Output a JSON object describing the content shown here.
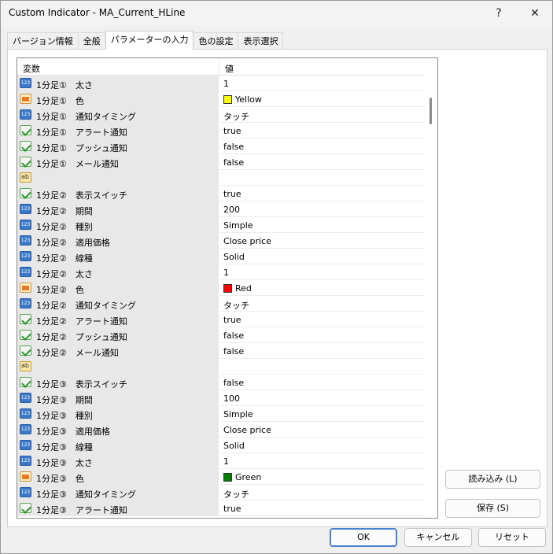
{
  "window": {
    "title": "Custom Indicator - MA_Current_HLine",
    "help_label": "?",
    "close_label": "✕"
  },
  "tabs": [
    {
      "label": "バージョン情報"
    },
    {
      "label": "全般"
    },
    {
      "label": "パラメーターの入力"
    },
    {
      "label": "色の設定"
    },
    {
      "label": "表示選択"
    }
  ],
  "grid": {
    "col_variable": "変数",
    "col_value": "値",
    "rows": [
      {
        "icon": "num",
        "name": "1分足①　太さ",
        "value": "1"
      },
      {
        "icon": "color",
        "name": "1分足①　色",
        "value": "Yellow",
        "swatch": "#ffff00"
      },
      {
        "icon": "num",
        "name": "1分足①　通知タイミング",
        "value": "タッチ"
      },
      {
        "icon": "bool",
        "name": "1分足①　アラート通知",
        "value": "true"
      },
      {
        "icon": "bool",
        "name": "1分足①　プッシュ通知",
        "value": "false"
      },
      {
        "icon": "bool",
        "name": "1分足①　メール通知",
        "value": "false"
      },
      {
        "icon": "str",
        "name": "",
        "value": ""
      },
      {
        "icon": "bool",
        "name": "1分足②　表示スイッチ",
        "value": "true"
      },
      {
        "icon": "num",
        "name": "1分足②　期間",
        "value": "200"
      },
      {
        "icon": "num",
        "name": "1分足②　種別",
        "value": "Simple"
      },
      {
        "icon": "num",
        "name": "1分足②　適用価格",
        "value": "Close price"
      },
      {
        "icon": "num",
        "name": "1分足②　線種",
        "value": "Solid"
      },
      {
        "icon": "num",
        "name": "1分足②　太さ",
        "value": "1"
      },
      {
        "icon": "color",
        "name": "1分足②　色",
        "value": "Red",
        "swatch": "#ff0000"
      },
      {
        "icon": "num",
        "name": "1分足②　通知タイミング",
        "value": "タッチ"
      },
      {
        "icon": "bool",
        "name": "1分足②　アラート通知",
        "value": "true"
      },
      {
        "icon": "bool",
        "name": "1分足②　プッシュ通知",
        "value": "false"
      },
      {
        "icon": "bool",
        "name": "1分足②　メール通知",
        "value": "false"
      },
      {
        "icon": "str",
        "name": "",
        "value": ""
      },
      {
        "icon": "bool",
        "name": "1分足③　表示スイッチ",
        "value": "false"
      },
      {
        "icon": "num",
        "name": "1分足③　期間",
        "value": "100"
      },
      {
        "icon": "num",
        "name": "1分足③　種別",
        "value": "Simple"
      },
      {
        "icon": "num",
        "name": "1分足③　適用価格",
        "value": "Close price"
      },
      {
        "icon": "num",
        "name": "1分足③　線種",
        "value": "Solid"
      },
      {
        "icon": "num",
        "name": "1分足③　太さ",
        "value": "1"
      },
      {
        "icon": "color",
        "name": "1分足③　色",
        "value": "Green",
        "swatch": "#008000"
      },
      {
        "icon": "num",
        "name": "1分足③　通知タイミング",
        "value": "タッチ"
      },
      {
        "icon": "bool",
        "name": "1分足③　アラート通知",
        "value": "true"
      }
    ]
  },
  "buttons": {
    "load": "読み込み (L)",
    "save": "保存 (S)",
    "ok": "OK",
    "cancel": "キャンセル",
    "reset": "リセット"
  }
}
